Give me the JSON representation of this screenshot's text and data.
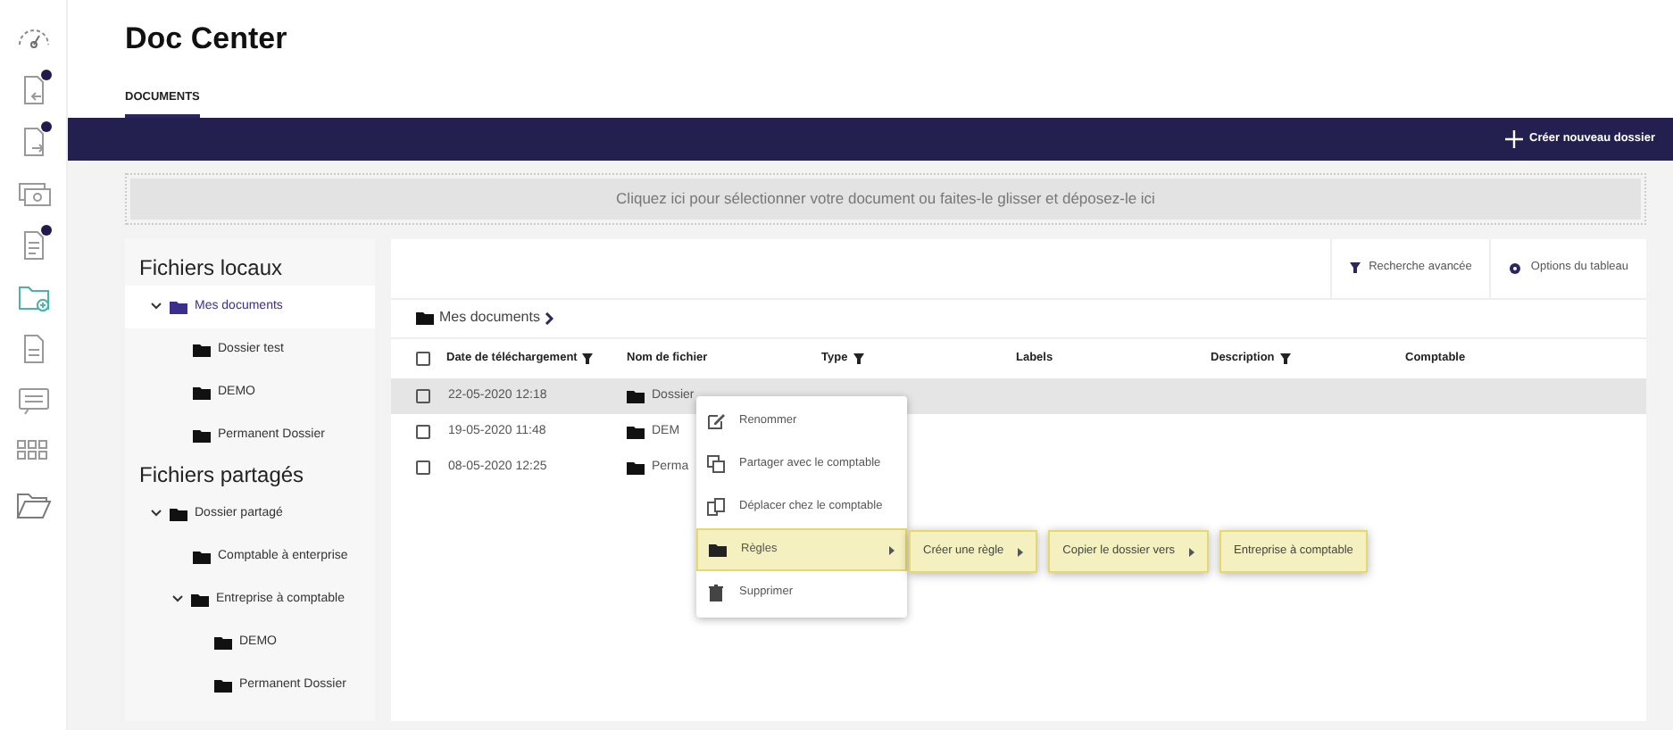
{
  "sidebar": [
    {
      "kind": "gauge",
      "badge": false,
      "selected": false
    },
    {
      "kind": "doc-in",
      "badge": true,
      "selected": false
    },
    {
      "kind": "doc-out",
      "badge": true,
      "selected": false
    },
    {
      "kind": "money",
      "badge": false,
      "selected": false
    },
    {
      "kind": "doc-list",
      "badge": true,
      "selected": false
    },
    {
      "kind": "folder-plus",
      "badge": false,
      "selected": true
    },
    {
      "kind": "doc",
      "badge": false,
      "selected": false
    },
    {
      "kind": "chat",
      "badge": false,
      "selected": false
    },
    {
      "kind": "grid",
      "badge": false,
      "selected": false
    },
    {
      "kind": "folder-open",
      "badge": false,
      "selected": false
    }
  ],
  "page_title": "Doc Center",
  "tabs": [
    {
      "label": "DOCUMENTS",
      "selected": true
    }
  ],
  "toolbar": {
    "create_button": "Créer nouveau dossier"
  },
  "dropzone": "Cliquez ici pour sélectionner votre document ou faites-le glisser et déposez-le ici",
  "tree_sections": [
    {
      "title": "Fichiers locaux",
      "items": [
        {
          "label": "Mes documents",
          "expanded": true,
          "selected": true,
          "children": [
            {
              "label": "Dossier test",
              "selected": false
            },
            {
              "label": "DEMO",
              "selected": false
            },
            {
              "label": "Permanent Dossier",
              "selected": false
            }
          ]
        }
      ]
    },
    {
      "title": "Fichiers partagés",
      "items": [
        {
          "label": "Dossier partagé",
          "expanded": true,
          "selected": false,
          "children": [
            {
              "label": "Comptable à enterprise",
              "selected": false
            },
            {
              "label": "Entreprise à comptable",
              "expanded": true,
              "selected": false,
              "children": [
                {
                  "label": "DEMO",
                  "selected": false
                },
                {
                  "label": "Permanent Dossier",
                  "selected": false
                }
              ]
            }
          ]
        }
      ]
    }
  ],
  "actions": [
    {
      "kind": "filter",
      "label": "Recherche avancée"
    },
    {
      "kind": "gear",
      "label": "Options du tableau"
    }
  ],
  "breadcrumb": "Mes documents",
  "table": {
    "columns": [
      {
        "label": "Date de téléchargement",
        "filter": true
      },
      {
        "label": "Nom de fichier",
        "filter": false
      },
      {
        "label": "Type",
        "filter": true
      },
      {
        "label": "Labels",
        "filter": false
      },
      {
        "label": "Description",
        "filter": true
      },
      {
        "label": "Comptable",
        "filter": false
      }
    ],
    "all_checked": false,
    "rows": [
      {
        "date": "22-05-2020 12:18",
        "name": "Dossier",
        "checked": false,
        "selected": true
      },
      {
        "date": "19-05-2020 11:48",
        "name": "DEM",
        "checked": false,
        "selected": false
      },
      {
        "date": "08-05-2020 12:25",
        "name": "Perma",
        "checked": false,
        "selected": false
      }
    ]
  },
  "context_menu": [
    {
      "kind": "edit",
      "label": "Renommer",
      "highlighted": false,
      "submenu": false
    },
    {
      "kind": "copy",
      "label": "Partager avec le comptable",
      "highlighted": false,
      "submenu": false
    },
    {
      "kind": "move",
      "label": "Déplacer chez le comptable",
      "highlighted": false,
      "submenu": false
    },
    {
      "kind": "folder",
      "label": "Règles",
      "highlighted": true,
      "submenu": true
    },
    {
      "kind": "trash",
      "label": "Supprimer",
      "highlighted": false,
      "submenu": false
    }
  ],
  "submenus": [
    {
      "label": "Créer une règle",
      "highlighted": true,
      "submenu": true
    },
    {
      "label": "Copier le dossier vers",
      "highlighted": true,
      "submenu": true
    },
    {
      "label": "Entreprise à comptable",
      "highlighted": true,
      "submenu": false
    }
  ]
}
